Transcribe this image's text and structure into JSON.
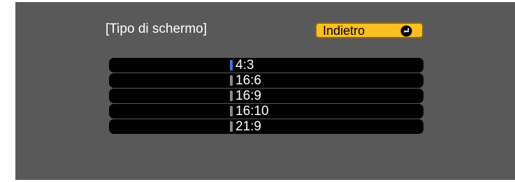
{
  "screen_title": "[Tipo di schermo]",
  "back_button": {
    "label": "Indietro",
    "icon": "enter-return-icon",
    "color": "#fbbf24"
  },
  "options": [
    {
      "label": "4:3",
      "selected": true
    },
    {
      "label": "16:6",
      "selected": false
    },
    {
      "label": "16:9",
      "selected": false
    },
    {
      "label": "16:10",
      "selected": false
    },
    {
      "label": "21:9",
      "selected": false
    }
  ],
  "colors": {
    "panel_background": "#595959",
    "row_background": "#000000",
    "selection_indicator": "#3a78d8",
    "unselected_indicator": "#8a8a8a"
  }
}
